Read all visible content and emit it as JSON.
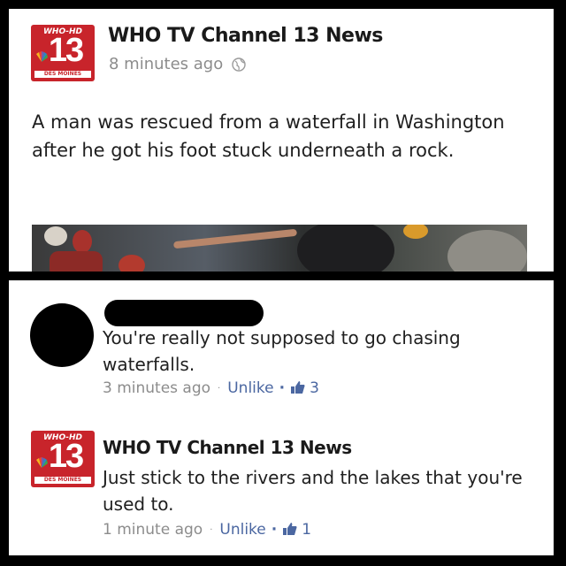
{
  "post": {
    "logo": {
      "top_text": "WHO-HD",
      "number": "13",
      "bottom_text": "DES MOINES",
      "brand_color": "#c8242b"
    },
    "author": "WHO TV Channel 13 News",
    "time": "8 minutes ago",
    "privacy_icon": "globe-icon",
    "text": "A man was rescued from a waterfall in Washington after he got his foot stuck underneath a rock."
  },
  "comments": [
    {
      "author": "",
      "text": "You're really not supposed to go chasing waterfalls.",
      "time": "3 minutes ago",
      "action": "Unlike",
      "likes": "3"
    },
    {
      "author": "WHO TV Channel 13 News",
      "logo": {
        "top_text": "WHO-HD",
        "number": "13",
        "bottom_text": "DES MOINES"
      },
      "text": "Just stick to the rivers and the lakes that you're used to.",
      "time": "1 minute ago",
      "action": "Unlike",
      "likes": "1"
    }
  ],
  "colors": {
    "link": "#4b67a1",
    "meta_gray": "#8c8c8c",
    "frame": "#000000"
  }
}
